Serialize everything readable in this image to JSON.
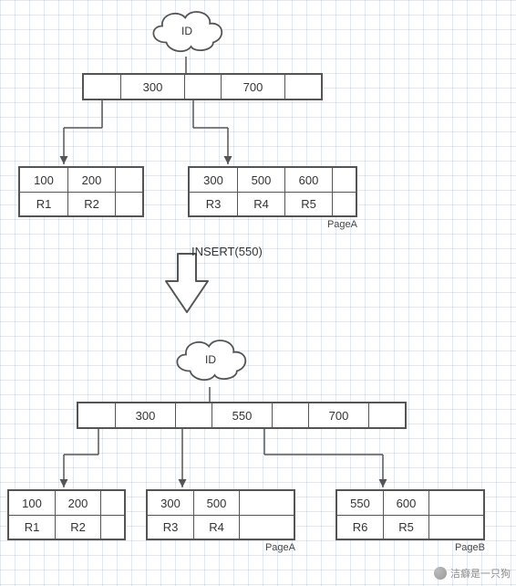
{
  "top": {
    "cloud_label": "ID",
    "root_keys": [
      "300",
      "700"
    ],
    "leaves": [
      {
        "keys": [
          "100",
          "200"
        ],
        "refs": [
          "R1",
          "R2"
        ],
        "page_label": ""
      },
      {
        "keys": [
          "300",
          "500",
          "600"
        ],
        "refs": [
          "R3",
          "R4",
          "R5"
        ],
        "page_label": "PageA"
      }
    ]
  },
  "transition_label": "INSERT(550)",
  "bottom": {
    "cloud_label": "ID",
    "root_keys": [
      "300",
      "550",
      "700"
    ],
    "leaves": [
      {
        "keys": [
          "100",
          "200"
        ],
        "refs": [
          "R1",
          "R2"
        ],
        "page_label": ""
      },
      {
        "keys": [
          "300",
          "500"
        ],
        "refs": [
          "R3",
          "R4"
        ],
        "page_label": "PageA"
      },
      {
        "keys": [
          "550",
          "600"
        ],
        "refs": [
          "R6",
          "R5"
        ],
        "page_label": "PageB"
      }
    ]
  },
  "watermark": "洁癖是一只狗"
}
